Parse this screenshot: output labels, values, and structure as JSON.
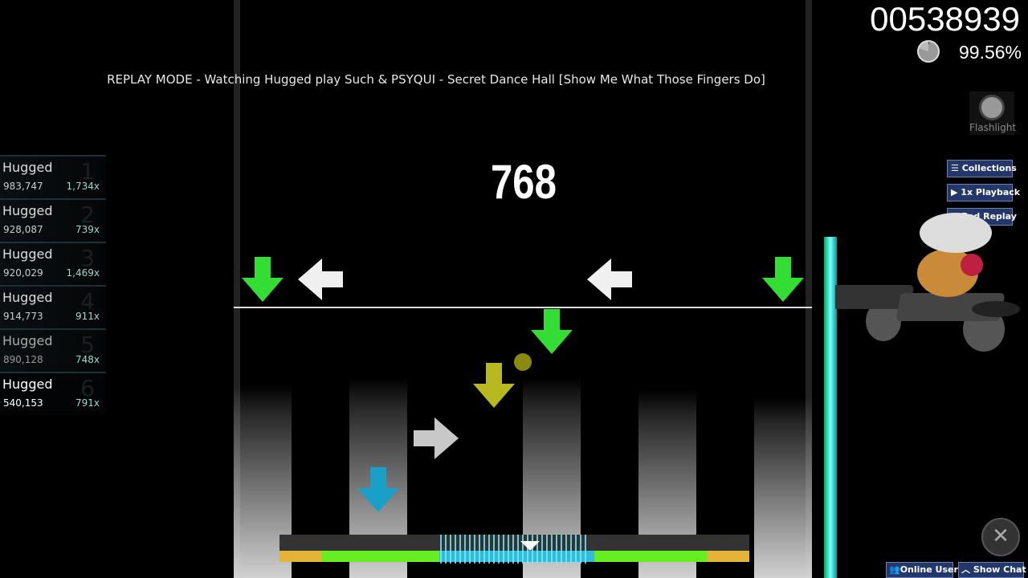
{
  "replay_banner": "REPLAY MODE - Watching Hugged play Such & PSYQUI - Secret Dance Hall [Show Me What Those Fingers Do]",
  "combo": "768",
  "score": "00538939",
  "accuracy": "99.56%",
  "mod": {
    "label": "Flashlight",
    "icon": "flashlight-mod-icon"
  },
  "menu_buttons": [
    {
      "label": "Collections",
      "icon": "list-icon"
    },
    {
      "label": "1x Playback",
      "icon": "play-icon"
    },
    {
      "label": "End Replay",
      "icon": "close-icon"
    }
  ],
  "leaderboard": [
    {
      "rank": "1",
      "name": "Hugged",
      "score": "983,747",
      "combo": "1,734x"
    },
    {
      "rank": "2",
      "name": "Hugged",
      "score": "928,087",
      "combo": "739x"
    },
    {
      "rank": "3",
      "name": "Hugged",
      "score": "920,029",
      "combo": "1,469x"
    },
    {
      "rank": "4",
      "name": "Hugged",
      "score": "914,773",
      "combo": "911x"
    },
    {
      "rank": "5",
      "name": "Hugged",
      "score": "890,128",
      "combo": "748x"
    },
    {
      "rank": "6",
      "name": "Hugged",
      "score": "540,153",
      "combo": "791x"
    }
  ],
  "bottom_buttons": [
    {
      "label": "Online Users",
      "icon": "users-icon"
    },
    {
      "label": "Show Chat",
      "icon": "chevron-up-icon"
    }
  ],
  "colors": {
    "green_note": "#33dd33",
    "white_note": "#f0f0f0",
    "yellow_note": "#b8b820",
    "blue_note": "#1a9fc8",
    "hp": "#55eeff",
    "menu_button": "#24376b"
  }
}
